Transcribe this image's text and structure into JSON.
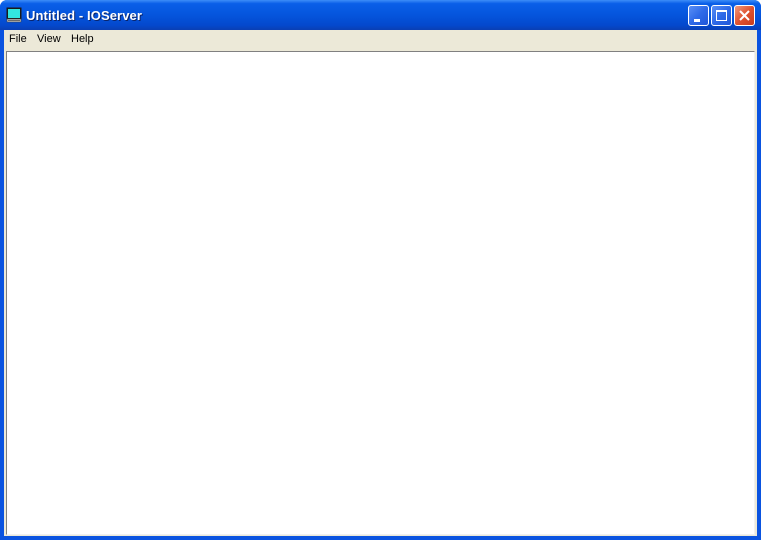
{
  "window": {
    "title": "Untitled - IOServer",
    "app_icon": "monitor-icon",
    "controls": {
      "minimize": "minimize-icon",
      "maximize": "maximize-icon",
      "close": "close-icon"
    }
  },
  "menubar": {
    "items": [
      {
        "label": "File"
      },
      {
        "label": "View"
      },
      {
        "label": "Help"
      }
    ]
  },
  "colors": {
    "titlebar": "#0555dd",
    "menubar": "#ece9d8",
    "close_button": "#e0522f",
    "client_area": "#ffffff"
  }
}
